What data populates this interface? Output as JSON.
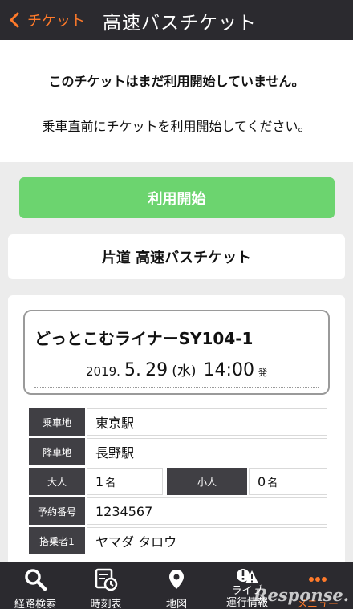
{
  "header": {
    "back_label": "チケット",
    "title": "高速バスチケット"
  },
  "notice": {
    "title": "このチケットはまだ利用開始していません。",
    "subtitle": "乗車直前にチケットを利用開始してください。"
  },
  "start_button": {
    "label": "利用開始"
  },
  "ticket_type": "片道 高速バスチケット",
  "bus": {
    "name": "どっとこむライナーSY104-1",
    "year": "2019.",
    "month": "5.",
    "day": "29",
    "weekday": "(水)",
    "time": "14:00",
    "departure_suffix": "発"
  },
  "info": {
    "boarding_label": "乗車地",
    "boarding_value": "東京駅",
    "alighting_label": "降車地",
    "alighting_value": "長野駅",
    "adult_label": "大人",
    "adult_count": "1",
    "adult_unit": "名",
    "child_label": "小人",
    "child_count": "0",
    "child_unit": "名",
    "reservation_label": "予約番号",
    "reservation_value": "1234567",
    "passenger_label": "搭乗者1",
    "passenger_value": "ヤマダ タロウ"
  },
  "tabs": [
    {
      "label": "経路検索",
      "icon": "search-icon"
    },
    {
      "label": "時刻表",
      "icon": "timetable-icon"
    },
    {
      "label": "地図",
      "icon": "map-pin-icon"
    },
    {
      "label": "ライブ運行情報",
      "line1": "ライブ",
      "line2": "運行情報",
      "icon": "alert-icon"
    },
    {
      "label": "メニュー",
      "icon": "more-icon"
    }
  ],
  "watermark": "Response.",
  "colors": {
    "accent_orange": "#ff7a2a",
    "start_green": "#6cd46f",
    "bar_dark": "#2b2a2f",
    "label_dark": "#403f44"
  }
}
